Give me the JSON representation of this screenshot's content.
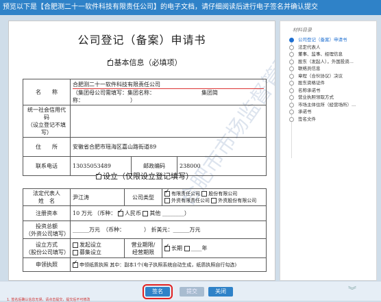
{
  "topbar": {
    "text": "预览以下是【合肥测二十一软件科技有限责任公司】的电子文档，请仔细阅读后进行电子签名并确认提交"
  },
  "document": {
    "title": "公司登记（备案）申请书",
    "watermark": "合肥市市场监督管理局",
    "section1": {
      "title": "基本信息（必填项）"
    },
    "basic": {
      "name_label": "名　　称",
      "name_value": "合肥测二十一软件科技有限责任公司",
      "group_line": "（集团母公司需填写：集团名称：　　　　　　　　　集团简称：　　　　　　　　　）",
      "credit_label": "统一社会信用代码\n（设立登记不填写）",
      "address_label": "住　　所",
      "address_value": "安徽省合肥市瑶海区嘉山路街道89",
      "phone_label": "联系电话",
      "phone_value": "13035053489",
      "postcode_label": "邮政编码",
      "postcode_value": "238000"
    },
    "section2": {
      "title": "设立（仅限设立登记填写）"
    },
    "setup": {
      "rep_label": "法定代表人\n姓　名",
      "rep_value": "尹江涛",
      "type_label": "公司类型",
      "type_options": [
        "有限责任公司",
        "股份有限公司",
        "外资有限责任公司",
        "外资股份有限公司"
      ],
      "capital_label": "注册资本",
      "capital_amount": "10",
      "capital_unit": "万元",
      "currency_label": "（币种：",
      "currency_rmb": "人民币",
      "currency_other": "其他",
      "invest_label": "投资总额\n（外资公司填写）",
      "invest_unit": "万元　（币种：　　　　）",
      "usd_label": "折美元：",
      "usd_unit": "万元",
      "method_label": "设立方式\n（股份公司填写）",
      "method_options": [
        "发起设立",
        "募集设立"
      ],
      "term_label": "营业期限/\n经营期限",
      "term_long": "长期",
      "term_years": "年",
      "license_label": "申领执照",
      "license_text": "申领纸质执照  其中：副本1个(电子执照系统自动生成，纸质执照自行勾选)"
    }
  },
  "sidebar": {
    "title": "材料目录",
    "items": [
      "公司登记（备案）申请书",
      "法定代表人",
      "董事、监事、经理信息",
      "股东（发起人），外国投资...",
      "联络员信息",
      "章程（合伙协议）决议",
      "股东资格证件",
      "名称承诺书",
      "营业执照领取方式",
      "市场主体住所（经营场所）...",
      "承诺书",
      "签名文件"
    ]
  },
  "buttons": {
    "sign": "签名",
    "submit": "提交",
    "close": "关闭"
  },
  "footer_note": "1. 签名后确认信息无误，请点击提交，提交后不可修改"
}
